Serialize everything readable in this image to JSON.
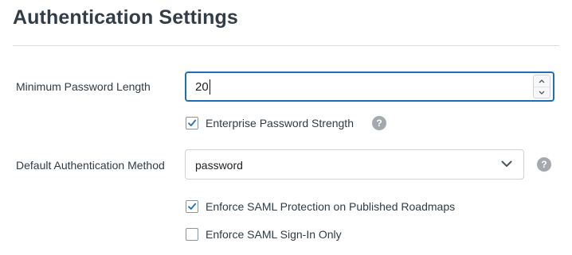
{
  "page": {
    "title": "Authentication Settings"
  },
  "min_password_length": {
    "label": "Minimum Password Length",
    "value": "20"
  },
  "enterprise_password_strength": {
    "label": "Enterprise Password Strength",
    "checked": true
  },
  "default_auth_method": {
    "label": "Default Authentication Method",
    "selected": "password"
  },
  "enforce_saml_protection": {
    "label": "Enforce SAML Protection on Published Roadmaps",
    "checked": true
  },
  "enforce_saml_signin": {
    "label": "Enforce SAML Sign-In Only",
    "checked": false
  },
  "help_icon": {
    "glyph": "?"
  },
  "colors": {
    "accent": "#1f6fb8",
    "title": "#333d47",
    "help_icon": "#a3a9ae"
  }
}
